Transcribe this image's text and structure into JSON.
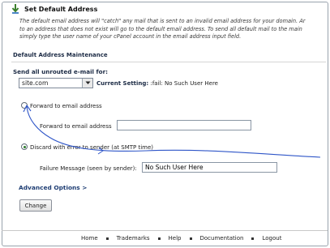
{
  "header": {
    "title": "Set Default Address",
    "icon": "cpanel-default-address-icon"
  },
  "description": {
    "lines": [
      "The default email address will \"catch\" any mail that is sent to an invalid email address for your domain. Ar",
      "to an address that does not exist will go to the default email address. To send all default mail to the main",
      "simply type the user name of your cPanel account in the email address input field."
    ]
  },
  "section": {
    "title": "Default Address Maintenance"
  },
  "send": {
    "label": "Send all unrouted e-mail for:",
    "domain_selected": "site.com",
    "current_setting_label": "Current Setting",
    "current_setting_value": ":fail: No Such User Here"
  },
  "forward": {
    "option_label": "Forward to email address",
    "field_label": "Forward to email address",
    "field_value": ""
  },
  "discard": {
    "option_label": "Discard with error to sender (at SMTP time)",
    "failure_label": "Failure Message (seen by sender):",
    "failure_value": "No Such User Here"
  },
  "advanced": {
    "label": "Advanced Options",
    "arrow": ">"
  },
  "change_button": "Change",
  "footer": {
    "links": [
      "Home",
      "Trademarks",
      "Help",
      "Documentation",
      "Logout"
    ]
  },
  "colors": {
    "section_heading": "#1b2a44",
    "link": "#1e3d73",
    "annotation_stroke": "#2f56c8"
  }
}
